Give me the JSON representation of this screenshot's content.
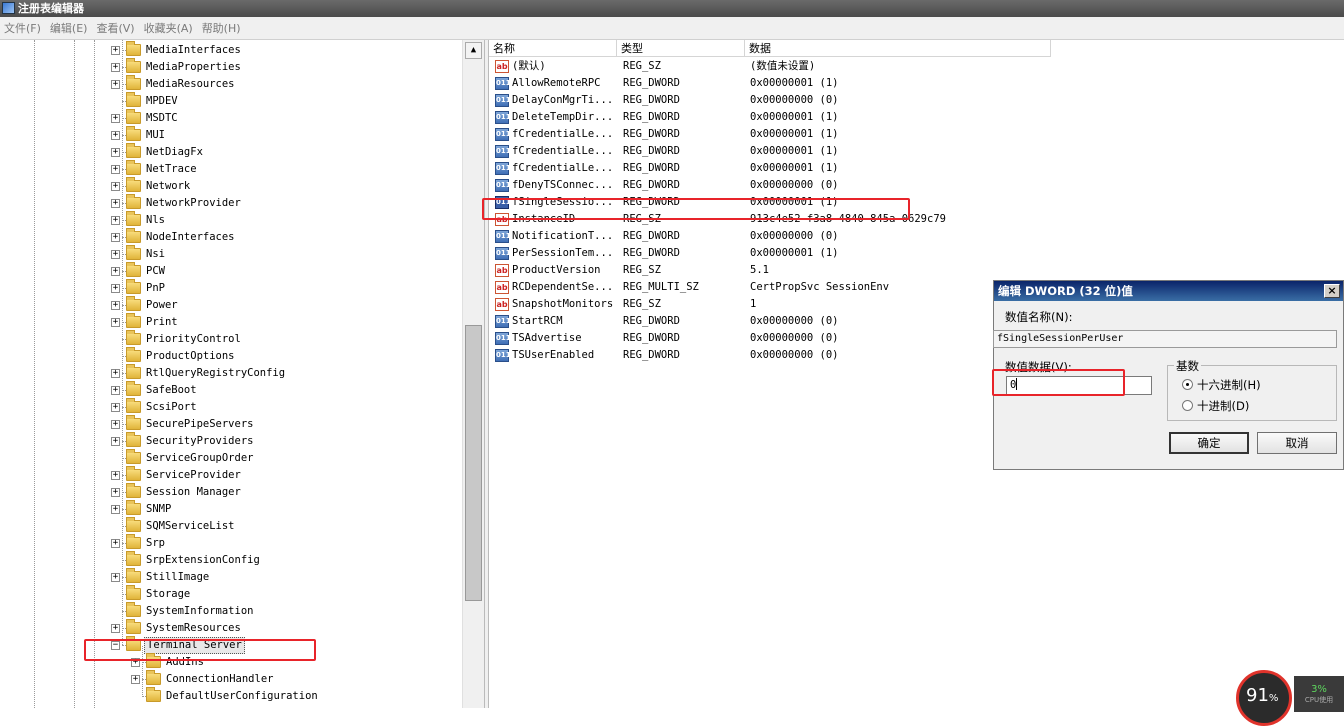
{
  "window": {
    "title": "注册表编辑器"
  },
  "menu": [
    "文件(F)",
    "编辑(E)",
    "查看(V)",
    "收藏夹(A)",
    "帮助(H)"
  ],
  "tree": {
    "items": [
      {
        "label": "MediaInterfaces",
        "expander": "+"
      },
      {
        "label": "MediaProperties",
        "expander": "+"
      },
      {
        "label": "MediaResources",
        "expander": "+"
      },
      {
        "label": "MPDEV",
        "expander": ""
      },
      {
        "label": "MSDTC",
        "expander": "+"
      },
      {
        "label": "MUI",
        "expander": "+"
      },
      {
        "label": "NetDiagFx",
        "expander": "+"
      },
      {
        "label": "NetTrace",
        "expander": "+"
      },
      {
        "label": "Network",
        "expander": "+"
      },
      {
        "label": "NetworkProvider",
        "expander": "+"
      },
      {
        "label": "Nls",
        "expander": "+"
      },
      {
        "label": "NodeInterfaces",
        "expander": "+"
      },
      {
        "label": "Nsi",
        "expander": "+"
      },
      {
        "label": "PCW",
        "expander": "+"
      },
      {
        "label": "PnP",
        "expander": "+"
      },
      {
        "label": "Power",
        "expander": "+"
      },
      {
        "label": "Print",
        "expander": "+"
      },
      {
        "label": "PriorityControl",
        "expander": ""
      },
      {
        "label": "ProductOptions",
        "expander": ""
      },
      {
        "label": "RtlQueryRegistryConfig",
        "expander": "+"
      },
      {
        "label": "SafeBoot",
        "expander": "+"
      },
      {
        "label": "ScsiPort",
        "expander": "+"
      },
      {
        "label": "SecurePipeServers",
        "expander": "+"
      },
      {
        "label": "SecurityProviders",
        "expander": "+"
      },
      {
        "label": "ServiceGroupOrder",
        "expander": ""
      },
      {
        "label": "ServiceProvider",
        "expander": "+"
      },
      {
        "label": "Session Manager",
        "expander": "+"
      },
      {
        "label": "SNMP",
        "expander": "+"
      },
      {
        "label": "SQMServiceList",
        "expander": ""
      },
      {
        "label": "Srp",
        "expander": "+"
      },
      {
        "label": "SrpExtensionConfig",
        "expander": ""
      },
      {
        "label": "StillImage",
        "expander": "+"
      },
      {
        "label": "Storage",
        "expander": ""
      },
      {
        "label": "SystemInformation",
        "expander": ""
      },
      {
        "label": "SystemResources",
        "expander": "+"
      },
      {
        "label": "Terminal Server",
        "expander": "−",
        "selected": true
      }
    ],
    "children": [
      {
        "label": "AddIns",
        "expander": "+"
      },
      {
        "label": "ConnectionHandler",
        "expander": "+"
      },
      {
        "label": "DefaultUserConfiguration",
        "expander": ""
      }
    ]
  },
  "list": {
    "columns": [
      "名称",
      "类型",
      "数据"
    ],
    "rows": [
      {
        "icon": "string-value-icon",
        "name": "(默认)",
        "type": "REG_SZ",
        "data": "(数值未设置)"
      },
      {
        "icon": "dword-value-icon",
        "name": "AllowRemoteRPC",
        "type": "REG_DWORD",
        "data": "0x00000001 (1)"
      },
      {
        "icon": "dword-value-icon",
        "name": "DelayConMgrTi...",
        "type": "REG_DWORD",
        "data": "0x00000000 (0)"
      },
      {
        "icon": "dword-value-icon",
        "name": "DeleteTempDir...",
        "type": "REG_DWORD",
        "data": "0x00000001 (1)"
      },
      {
        "icon": "dword-value-icon",
        "name": "fCredentialLe...",
        "type": "REG_DWORD",
        "data": "0x00000001 (1)"
      },
      {
        "icon": "dword-value-icon",
        "name": "fCredentialLe...",
        "type": "REG_DWORD",
        "data": "0x00000001 (1)"
      },
      {
        "icon": "dword-value-icon",
        "name": "fCredentialLe...",
        "type": "REG_DWORD",
        "data": "0x00000001 (1)"
      },
      {
        "icon": "dword-value-icon",
        "name": "fDenyTSConnec...",
        "type": "REG_DWORD",
        "data": "0x00000000 (0)"
      },
      {
        "icon": "dword-value-icon",
        "name": "fSingleSessio...",
        "type": "REG_DWORD",
        "data": "0x00000001 (1)",
        "selected": true
      },
      {
        "icon": "string-value-icon",
        "name": "InstanceID",
        "type": "REG_SZ",
        "data": "913c4e52-f3a8-4840-845a-0629c79"
      },
      {
        "icon": "dword-value-icon",
        "name": "NotificationT...",
        "type": "REG_DWORD",
        "data": "0x00000000 (0)"
      },
      {
        "icon": "dword-value-icon",
        "name": "PerSessionTem...",
        "type": "REG_DWORD",
        "data": "0x00000001 (1)"
      },
      {
        "icon": "string-value-icon",
        "name": "ProductVersion",
        "type": "REG_SZ",
        "data": "5.1"
      },
      {
        "icon": "string-value-icon",
        "name": "RCDependentSe...",
        "type": "REG_MULTI_SZ",
        "data": "CertPropSvc SessionEnv"
      },
      {
        "icon": "string-value-icon",
        "name": "SnapshotMonitors",
        "type": "REG_SZ",
        "data": "1"
      },
      {
        "icon": "dword-value-icon",
        "name": "StartRCM",
        "type": "REG_DWORD",
        "data": "0x00000000 (0)"
      },
      {
        "icon": "dword-value-icon",
        "name": "TSAdvertise",
        "type": "REG_DWORD",
        "data": "0x00000000 (0)"
      },
      {
        "icon": "dword-value-icon",
        "name": "TSUserEnabled",
        "type": "REG_DWORD",
        "data": "0x00000000 (0)"
      }
    ]
  },
  "dialog": {
    "title": "编辑 DWORD (32 位)值",
    "close": "×",
    "name_label": "数值名称(N):",
    "name_value": "fSingleSessionPerUser",
    "data_label": "数值数据(V):",
    "data_value": "0",
    "base_label": "基数",
    "radio_hex": "十六进制(H)",
    "radio_dec": "十进制(D)",
    "selected_base": "hex",
    "ok": "确定",
    "cancel": "取消"
  },
  "perf": {
    "cpu_percent": "91",
    "percent_sign": "%",
    "side_value": "3%",
    "side_label": "CPU使用"
  },
  "colors": {
    "highlight_box": "#e8242a",
    "dialog_title": "#0a246a"
  }
}
